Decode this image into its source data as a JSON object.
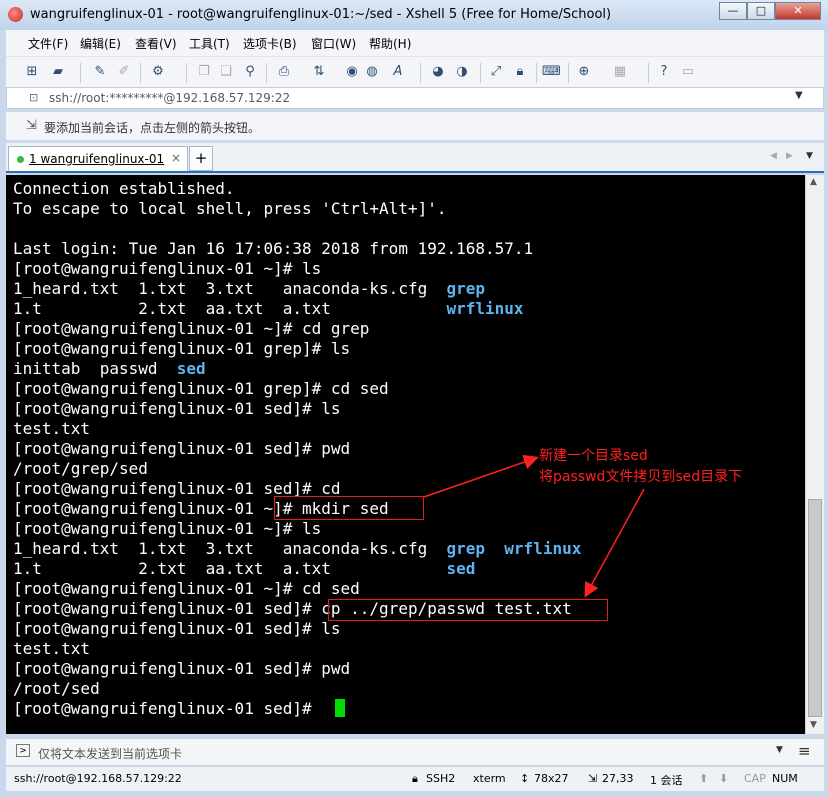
{
  "window": {
    "title": "wangruifenglinux-01 - root@wangruifenglinux-01:~/sed - Xshell 5 (Free for Home/School)",
    "minimize": "—",
    "maximize": "□",
    "close": "✕"
  },
  "menu": [
    "文件(F)",
    "编辑(E)",
    "查看(V)",
    "工具(T)",
    "选项卡(B)",
    "窗口(W)",
    "帮助(H)"
  ],
  "address": "ssh://root:*********@192.168.57.129:22",
  "hint": "要添加当前会话，点击左侧的箭头按钮。",
  "tab": {
    "number": "1",
    "label": " wangruifenglinux-01",
    "close": "×",
    "add": "+"
  },
  "terminal": {
    "lines": [
      [
        {
          "t": "Connection established."
        }
      ],
      [
        {
          "t": "To escape to local shell, press 'Ctrl+Alt+]'."
        }
      ],
      [
        {
          "t": ""
        }
      ],
      [
        {
          "t": "Last login: Tue Jan 16 17:06:38 2018 from 192.168.57.1"
        }
      ],
      [
        {
          "t": "[root@wangruifenglinux-01 ~]# ls"
        }
      ],
      [
        {
          "t": "1_heard.txt  1.txt  3.txt   anaconda-ks.cfg  "
        },
        {
          "t": "grep",
          "b": true
        }
      ],
      [
        {
          "t": "1.t          2.txt  aa.txt  a.txt            "
        },
        {
          "t": "wrflinux",
          "b": true
        }
      ],
      [
        {
          "t": "[root@wangruifenglinux-01 ~]# cd grep"
        }
      ],
      [
        {
          "t": "[root@wangruifenglinux-01 grep]# ls"
        }
      ],
      [
        {
          "t": "inittab  passwd  "
        },
        {
          "t": "sed",
          "b": true
        }
      ],
      [
        {
          "t": "[root@wangruifenglinux-01 grep]# cd sed"
        }
      ],
      [
        {
          "t": "[root@wangruifenglinux-01 sed]# ls"
        }
      ],
      [
        {
          "t": "test.txt"
        }
      ],
      [
        {
          "t": "[root@wangruifenglinux-01 sed]# pwd"
        }
      ],
      [
        {
          "t": "/root/grep/sed"
        }
      ],
      [
        {
          "t": "[root@wangruifenglinux-01 sed]# cd"
        }
      ],
      [
        {
          "t": "[root@wangruifenglinux-01 ~]# mkdir sed"
        }
      ],
      [
        {
          "t": "[root@wangruifenglinux-01 ~]# ls"
        }
      ],
      [
        {
          "t": "1_heard.txt  1.txt  3.txt   anaconda-ks.cfg  "
        },
        {
          "t": "grep",
          "b": true
        },
        {
          "t": "  "
        },
        {
          "t": "wrflinux",
          "b": true
        }
      ],
      [
        {
          "t": "1.t          2.txt  aa.txt  a.txt            "
        },
        {
          "t": "sed",
          "b": true
        }
      ],
      [
        {
          "t": "[root@wangruifenglinux-01 ~]# cd sed"
        }
      ],
      [
        {
          "t": "[root@wangruifenglinux-01 sed]# cp ../grep/passwd test.txt"
        }
      ],
      [
        {
          "t": "[root@wangruifenglinux-01 sed]# ls"
        }
      ],
      [
        {
          "t": "test.txt"
        }
      ],
      [
        {
          "t": "[root@wangruifenglinux-01 sed]# pwd"
        }
      ],
      [
        {
          "t": "/root/sed"
        }
      ],
      [
        {
          "t": "[root@wangruifenglinux-01 sed]# "
        }
      ]
    ]
  },
  "annotation": {
    "line1": "新建一个目录sed",
    "line2": "将passwd文件拷贝到sed目录下",
    "color": "#ff2020"
  },
  "sendbar": {
    "placeholder": "仅将文本发送到当前选项卡"
  },
  "status": {
    "connection": "ssh://root@192.168.57.129:22",
    "protocol": "SSH2",
    "term": "xterm",
    "size": "78x27",
    "position": "27,33",
    "sessions": "1 会话",
    "cap": "CAP",
    "num": "NUM"
  }
}
